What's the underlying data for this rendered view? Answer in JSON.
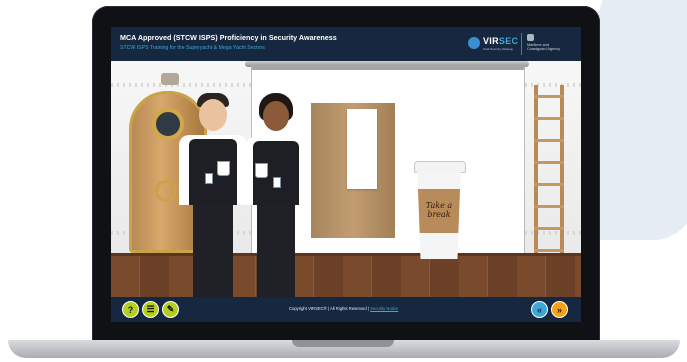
{
  "course": {
    "title": "MCA Approved (STCW ISPS) Proficiency in Security Awareness",
    "subtitle": "STCW ISPS Training for the Superyacht & Mega Yacht Sectors"
  },
  "logo": {
    "brand_part1": "VIR",
    "brand_part2": "SEC",
    "tagline": "Total Security Strategy",
    "agency_line1": "Maritime and",
    "agency_line2": "Coastguard Agency"
  },
  "slide": {
    "cup_text_line1": "Take a",
    "cup_text_line2": "break"
  },
  "footer": {
    "copyright": "Copyright VIRSEC® | All Rights Reserved | ",
    "security_notice": "Security Notice",
    "help_label": "?",
    "menu_label": "☰",
    "notes_label": "✎",
    "back_label": "«",
    "next_label": "»"
  },
  "colors": {
    "header": "#16283f",
    "accent": "#3ea7d6",
    "left_buttons": "#b5cf1f",
    "right_buttons": "#f5a21b",
    "back_button": "#3ea7d6"
  }
}
